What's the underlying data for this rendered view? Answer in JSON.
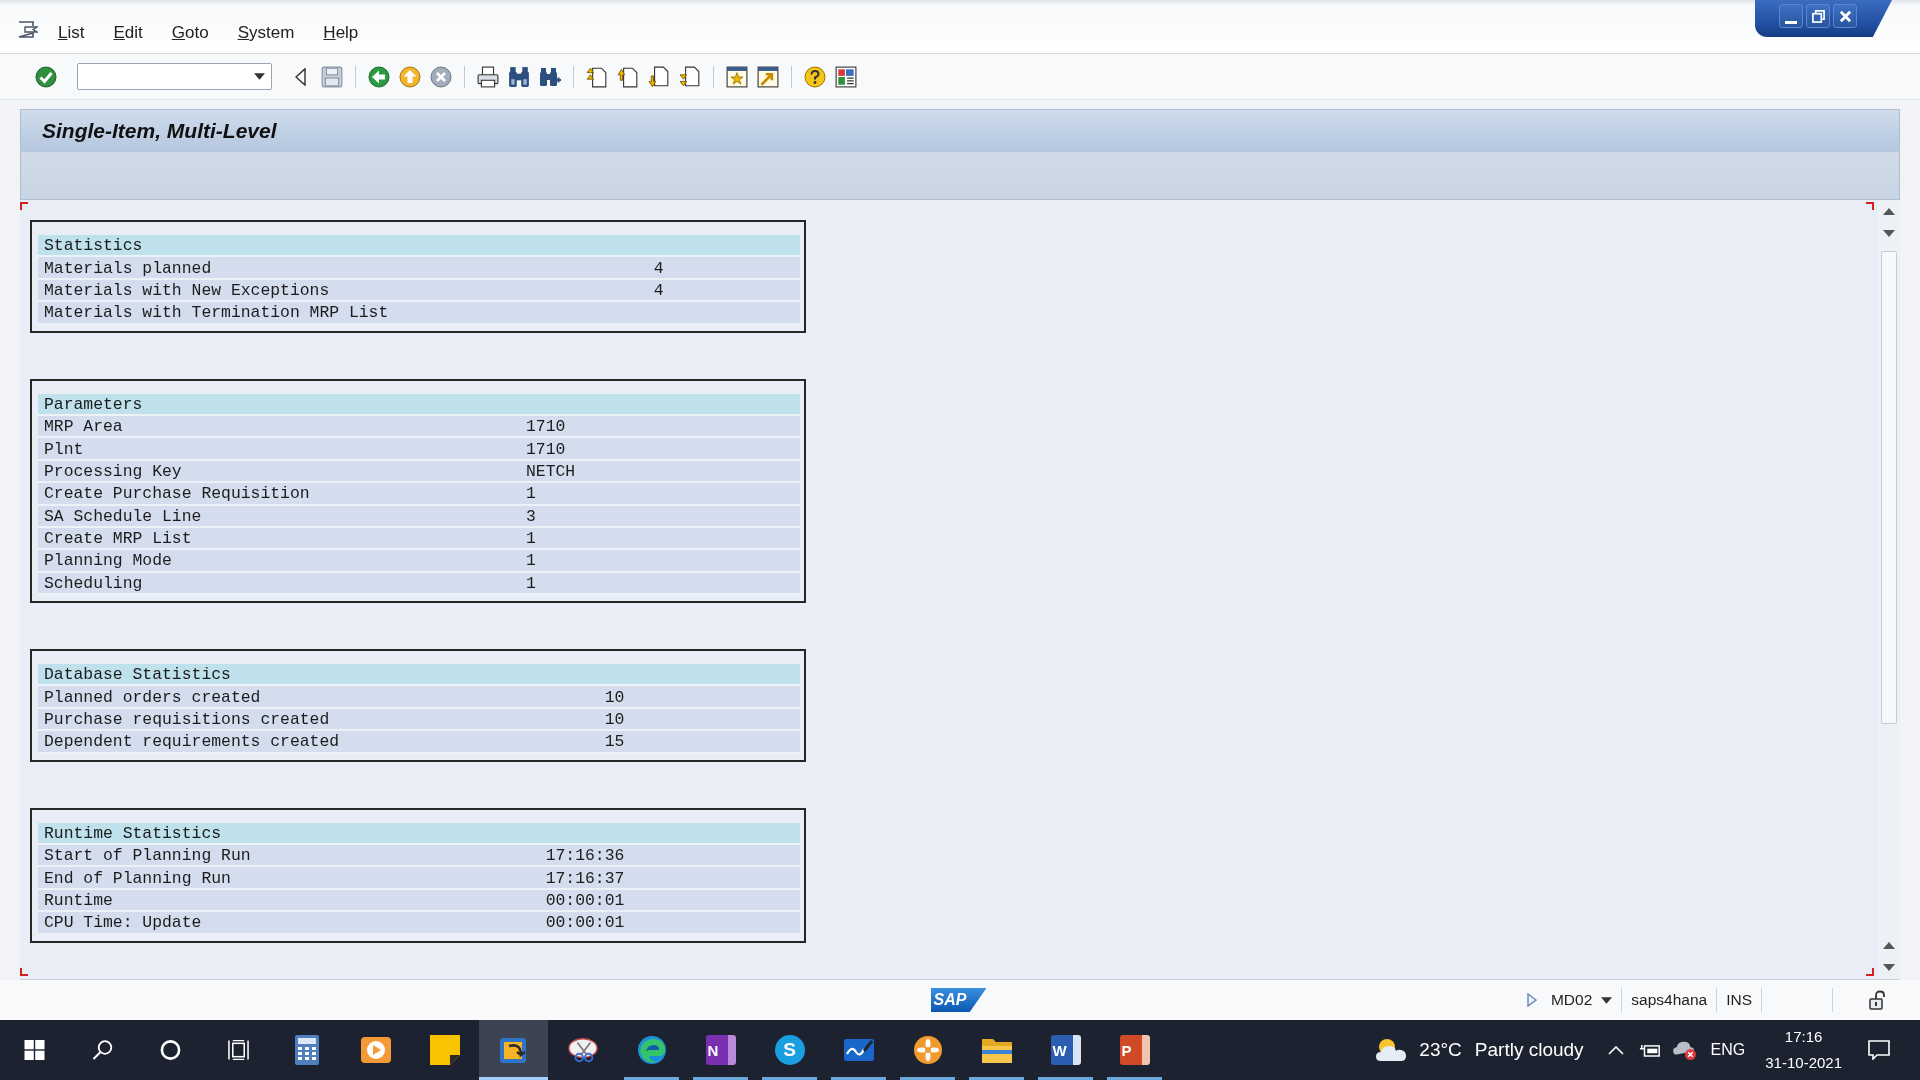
{
  "menu_bar": {
    "items": [
      "List",
      "Edit",
      "Goto",
      "System",
      "Help"
    ]
  },
  "screen_title": "Single-Item, Multi-Level",
  "sections": [
    {
      "heading": "Statistics",
      "rows": [
        {
          "label": "Materials planned",
          "value": "4"
        },
        {
          "label": "Materials with New Exceptions",
          "value": "4"
        },
        {
          "label": "Materials with Termination MRP List"
        }
      ]
    },
    {
      "heading": "Parameters",
      "rows": [
        {
          "label": "MRP Area",
          "value": "1710"
        },
        {
          "label": "Plnt",
          "value": "1710"
        },
        {
          "label": "Processing Key",
          "value": "NETCH"
        },
        {
          "label": "Create Purchase Requisition",
          "value": "1"
        },
        {
          "label": "SA Schedule Line",
          "value": "3"
        },
        {
          "label": "Create MRP List",
          "value": "1"
        },
        {
          "label": "Planning Mode",
          "value": "1"
        },
        {
          "label": "Scheduling",
          "value": "1"
        }
      ]
    },
    {
      "heading": "Database Statistics",
      "rows": [
        {
          "label": "Planned orders created",
          "value": "10"
        },
        {
          "label": "Purchase requisitions created",
          "value": "10"
        },
        {
          "label": "Dependent requirements created",
          "value": "15"
        }
      ]
    },
    {
      "heading": "Runtime Statistics",
      "rows": [
        {
          "label": "Start of Planning Run",
          "value": "17:16:36"
        },
        {
          "label": "End of Planning Run",
          "value": "17:16:37"
        },
        {
          "label": "Runtime",
          "value": "00:00:01"
        },
        {
          "label": "CPU Time: Update",
          "value": "00:00:01"
        }
      ]
    }
  ],
  "status_bar": {
    "logo": "SAP",
    "transaction": "MD02",
    "system": "saps4hana",
    "input_mode": "INS"
  },
  "taskbar": {
    "apps": [
      {
        "kind": "calculator",
        "selected": false,
        "running": false
      },
      {
        "kind": "player",
        "selected": false,
        "running": false
      },
      {
        "kind": "stickynote",
        "selected": false,
        "running": false
      },
      {
        "kind": "logon",
        "selected": true,
        "running": true
      },
      {
        "kind": "snipping",
        "selected": false,
        "running": false
      },
      {
        "kind": "browser",
        "selected": false,
        "running": true
      },
      {
        "kind": "notebook",
        "label": "N",
        "selected": false,
        "running": true
      },
      {
        "kind": "messenger",
        "label": "S",
        "selected": false,
        "running": true
      },
      {
        "kind": "whiteboard",
        "selected": false,
        "running": true
      },
      {
        "kind": "flower",
        "selected": false,
        "running": true
      },
      {
        "kind": "folder",
        "selected": false,
        "running": true
      },
      {
        "kind": "document",
        "label": "W",
        "selected": false,
        "running": true
      },
      {
        "kind": "slides",
        "label": "P",
        "selected": false,
        "running": true
      }
    ],
    "tray": {
      "temperature": "23°C",
      "weather": "Partly cloudy",
      "language": "ENG",
      "time": "17:16",
      "date": "31-10-2021"
    }
  }
}
